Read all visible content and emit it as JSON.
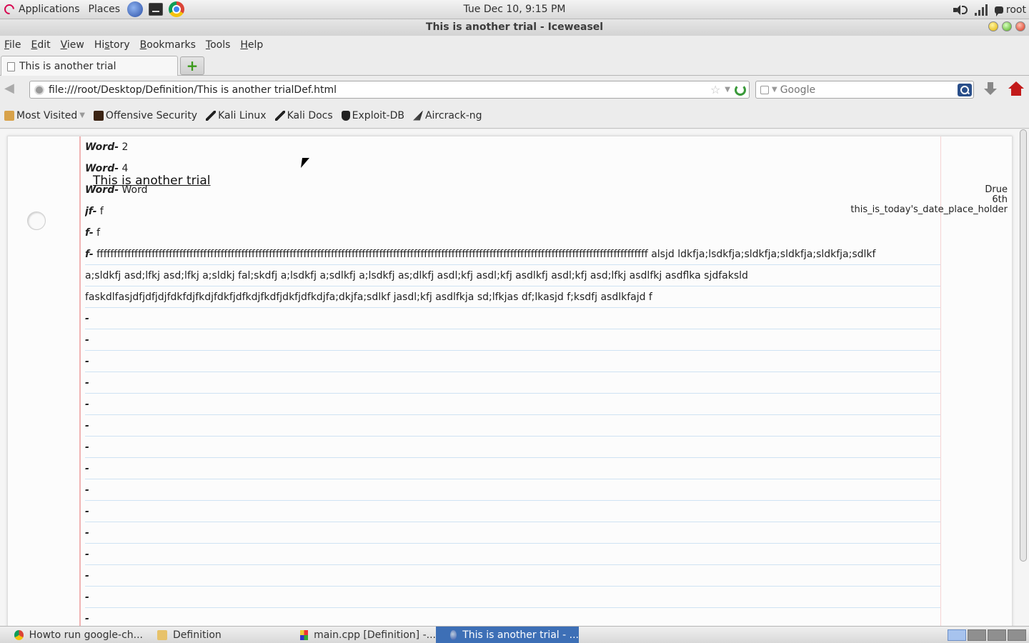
{
  "panel": {
    "applications": "Applications",
    "places": "Places",
    "clock": "Tue Dec 10,  9:15 PM",
    "user": "root"
  },
  "window": {
    "title": "This is another trial - Iceweasel"
  },
  "menu": [
    "File",
    "Edit",
    "View",
    "History",
    "Bookmarks",
    "Tools",
    "Help"
  ],
  "menu_access": [
    "F",
    "E",
    "V",
    "s",
    "B",
    "T",
    "H"
  ],
  "tab": {
    "title": "This is another trial"
  },
  "nav": {
    "url": "file:///root/Desktop/Definition/This is another trialDef.html",
    "search_placeholder": "Google"
  },
  "bookmarks": [
    {
      "label": "Most Visited",
      "icon": "folder-icon"
    },
    {
      "label": "Offensive Security",
      "icon": "offsec-icon"
    },
    {
      "label": "Kali Linux",
      "icon": "kali-dragon-icon"
    },
    {
      "label": "Kali Docs",
      "icon": "kali-dragon-icon"
    },
    {
      "label": "Exploit-DB",
      "icon": "exploit-db-icon"
    },
    {
      "label": "Aircrack-ng",
      "icon": "aircrack-icon"
    }
  ],
  "page": {
    "heading": "This is another trial",
    "meta": [
      "Drue",
      "6th",
      "this_is_today's_date_place_holder"
    ],
    "rows": [
      {
        "term": "Word-",
        "def": "2"
      },
      {
        "term": "Word-",
        "def": "4"
      },
      {
        "term": "Word-",
        "def": "Word"
      },
      {
        "term": "jf-",
        "def": "f"
      },
      {
        "term": "f-",
        "def": "f"
      },
      {
        "term": "f-",
        "def": "ffffffffffffffffffffffffffffffffffffffffffffffffffffffffffffffffffffffffffffffffffffffffffffffffffffffffffffffffffffffffffffffffffffffffffffffffffffffffffffffff alsjd ldkfja;lsdkfja;sldkfja;sldkfja;sldkfja;sdlkf"
      },
      {
        "term": "",
        "def": "a;sldkfj asd;lfkj asd;lfkj a;sldkj fal;skdfj a;lsdkfj a;sdlkfj a;lsdkfj as;dlkfj asdl;kfj asdl;kfj asdlkfj asdl;kfj asd;lfkj asdlfkj asdflka sjdfaksld"
      },
      {
        "term": "",
        "def": "faskdlfasjdfjdfjdjfdkfdjfkdjfdkfjdfkdjfkdfjdkfjdfkdjfa;dkjfa;sdlkf jasdl;kfj asdlfkja sd;lfkjas df;lkasjd f;ksdfj asdlkfajd f"
      },
      {
        "term": "-",
        "def": ""
      },
      {
        "term": "-",
        "def": ""
      },
      {
        "term": "-",
        "def": ""
      },
      {
        "term": "-",
        "def": ""
      },
      {
        "term": "-",
        "def": ""
      },
      {
        "term": "-",
        "def": ""
      },
      {
        "term": "-",
        "def": ""
      },
      {
        "term": "-",
        "def": ""
      },
      {
        "term": "-",
        "def": ""
      },
      {
        "term": "-",
        "def": ""
      },
      {
        "term": "-",
        "def": ""
      },
      {
        "term": "-",
        "def": ""
      },
      {
        "term": "-",
        "def": ""
      },
      {
        "term": "-",
        "def": ""
      },
      {
        "term": "-",
        "def": ""
      }
    ]
  },
  "taskbar": [
    {
      "label": "Howto run google-ch...",
      "icon": "chrome-icon",
      "active": false
    },
    {
      "label": "Definition",
      "icon": "folder-icon",
      "active": false
    },
    {
      "label": "main.cpp [Definition] -...",
      "icon": "codeblocks-icon",
      "active": false
    },
    {
      "label": "This is another trial - ...",
      "icon": "iceweasel-icon",
      "active": true
    }
  ],
  "colors": {
    "margin_line": "#f0b4b4",
    "rule_line": "#cfe3f3",
    "active_task": "#3d6fb6"
  }
}
